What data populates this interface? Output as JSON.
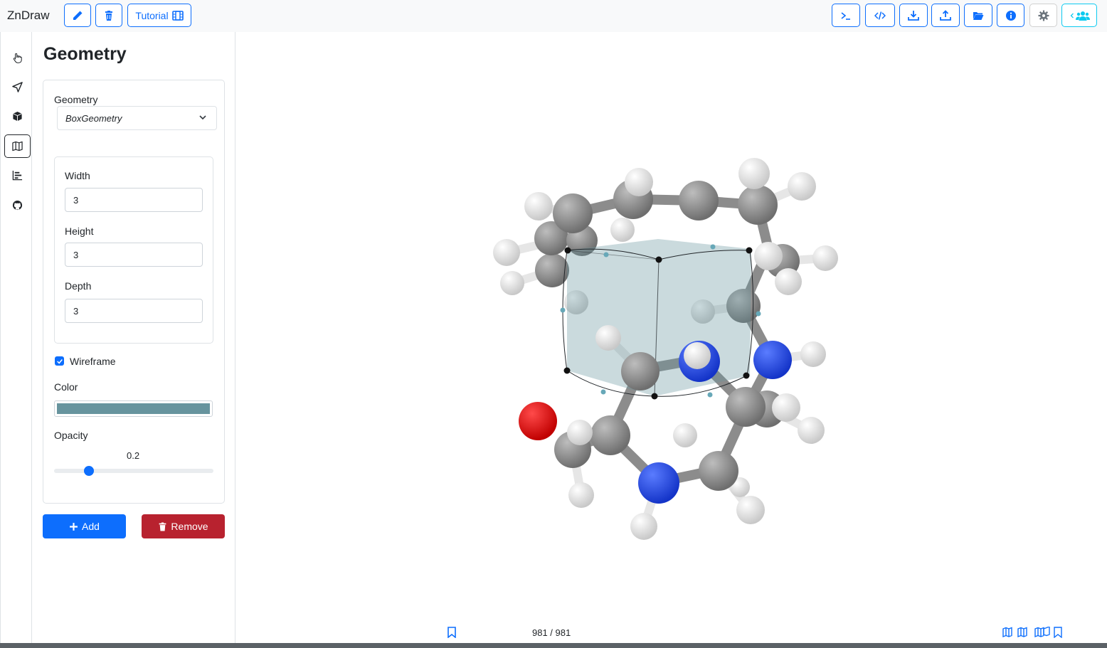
{
  "app": {
    "title": "ZnDraw"
  },
  "toolbar": {
    "tutorial_label": "Tutorial",
    "left_buttons": [
      "pencil-icon",
      "trash-icon"
    ],
    "right_buttons": [
      "terminal-icon",
      "code-icon",
      "download-icon",
      "upload-icon",
      "folder-open-icon",
      "info-icon",
      "gear-icon",
      "users-icon"
    ]
  },
  "sidebar": {
    "items": [
      "hand-pointer-icon",
      "location-arrow-icon",
      "cube-icon",
      "map-icon",
      "chart-bar-icon",
      "github-icon"
    ],
    "active_index": 3
  },
  "panel": {
    "title": "Geometry",
    "geometry_label": "Geometry",
    "geometry_value": "BoxGeometry",
    "width_label": "Width",
    "width_value": "3",
    "height_label": "Height",
    "height_value": "3",
    "depth_label": "Depth",
    "depth_value": "3",
    "wireframe_label": "Wireframe",
    "wireframe_checked": true,
    "color_label": "Color",
    "color_value": "#67949e",
    "opacity_label": "Opacity",
    "opacity_value": "0.2",
    "add_label": "Add",
    "remove_label": "Remove"
  },
  "footer": {
    "frame_counter": "981 / 981"
  },
  "colors": {
    "primary": "#0d6efd",
    "danger": "#b8222f",
    "info": "#0dcaf0",
    "carbon": "#8a8a8a",
    "nitrogen": "#2b4ee0",
    "oxygen": "#e0171b",
    "hydrogen": "#f2f2f2"
  }
}
